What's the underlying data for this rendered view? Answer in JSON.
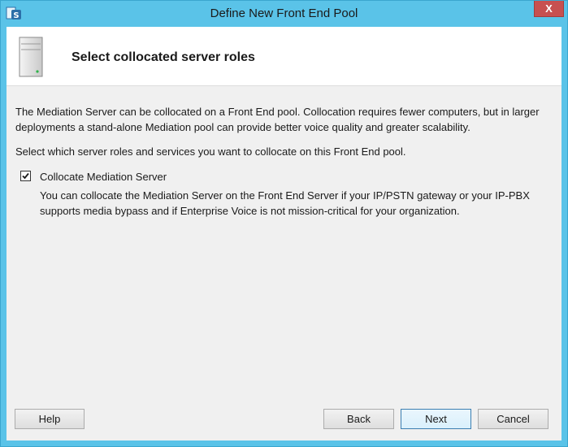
{
  "window": {
    "title": "Define New Front End Pool",
    "close_label": "X"
  },
  "header": {
    "title": "Select collocated server roles",
    "icon": "server-icon"
  },
  "content": {
    "intro": "The Mediation Server can be collocated on a Front End pool. Collocation requires fewer computers, but in larger deployments a stand-alone Mediation pool can provide better voice quality and greater scalability.",
    "select_prompt": "Select which server roles and services you want to collocate on this Front End pool.",
    "collocate_option": {
      "label": "Collocate Mediation Server",
      "checked": true,
      "description": "You can collocate the Mediation Server on the Front End Server if your IP/PSTN gateway or your IP-PBX supports media bypass and if Enterprise Voice is not mission-critical for your organization."
    }
  },
  "buttons": {
    "help": "Help",
    "back": "Back",
    "next": "Next",
    "cancel": "Cancel"
  },
  "colors": {
    "titlebar": "#5ac3e8",
    "close_button": "#c75050",
    "client_bg": "#f0f0f0"
  }
}
